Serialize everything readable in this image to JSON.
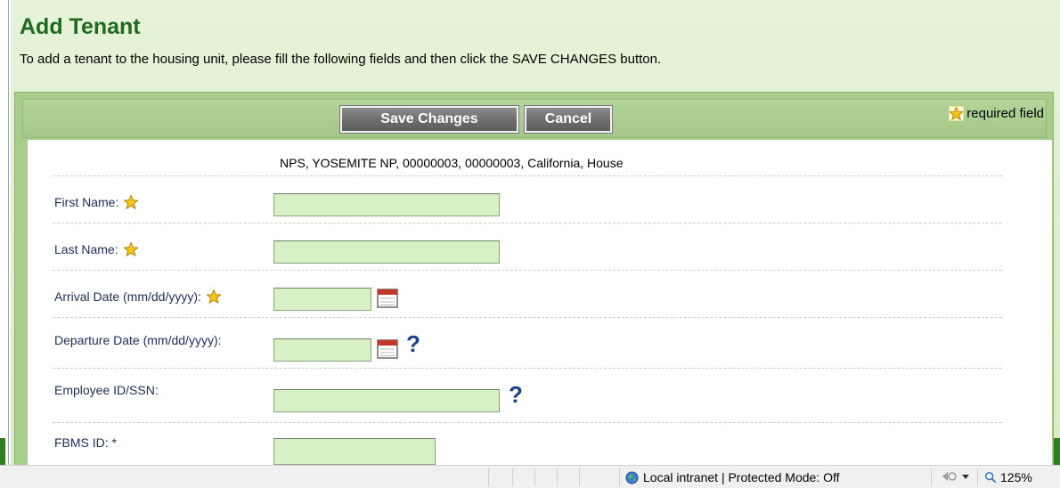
{
  "page": {
    "title": "Add Tenant",
    "instruction": "To add a tenant to the housing unit, please fill the following fields and then click the SAVE CHANGES button."
  },
  "toolbar": {
    "save_label": "Save Changes",
    "cancel_label": "Cancel",
    "required_legend": "required field"
  },
  "unit_info": "NPS, YOSEMITE NP, 00000003, 00000003, California, House",
  "fields": {
    "first_name": {
      "label": "First Name:",
      "value": ""
    },
    "last_name": {
      "label": "Last Name:",
      "value": ""
    },
    "arrival_date": {
      "label": "Arrival Date (mm/dd/yyyy):",
      "value": ""
    },
    "departure_date": {
      "label": "Departure Date (mm/dd/yyyy):",
      "value": ""
    },
    "employee_id": {
      "label": "Employee ID/SSN:",
      "value": ""
    },
    "fbms_id": {
      "label": "FBMS ID: *",
      "value": ""
    }
  },
  "icons": {
    "required": "star-icon",
    "calendar": "calendar-icon",
    "help": "help-icon",
    "zone": "globe-icon",
    "zoom": "magnifier-icon"
  },
  "help_glyph": "?",
  "status_bar": {
    "zone_text": "Local intranet | Protected Mode: Off",
    "zoom": "125%"
  },
  "colors": {
    "title": "#1f6a1f",
    "panel": "#a8cc8a",
    "input_bg": "#d8f1c4",
    "button": "#6f6f6f"
  }
}
